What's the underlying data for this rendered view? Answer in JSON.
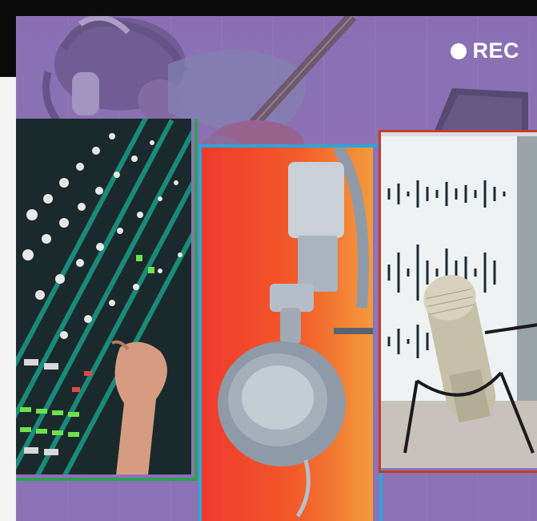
{
  "recording_indicator": {
    "label": "REC"
  },
  "images": {
    "background": "guitarist-with-headphones-photo",
    "cards": [
      {
        "subject": "mixing-console-photo",
        "border_color": "#2ea052"
      },
      {
        "subject": "studio-headphones-photo",
        "border_color": "#2aa5de"
      },
      {
        "subject": "podcast-microphone-photo",
        "border_color": "#c43b2a"
      }
    ]
  },
  "colors": {
    "overlay": "#8a70b3",
    "rec_text": "#ffffff"
  }
}
